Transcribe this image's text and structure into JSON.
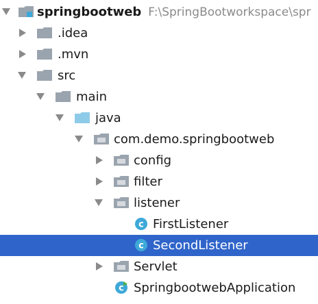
{
  "project": {
    "name": "springbootweb",
    "path": "F:\\SpringBootworkspace\\spr"
  },
  "tree": {
    "idea": ".idea",
    "mvn": ".mvn",
    "src": "src",
    "main": "main",
    "java": "java",
    "package": "com.demo.springbootweb",
    "config": "config",
    "filter": "filter",
    "listener": "listener",
    "first_listener": "FirstListener",
    "second_listener": "SecondListener",
    "servlet": "Servlet",
    "application": "SpringbootwebApplication"
  },
  "colors": {
    "selection": "#2f65ca",
    "folder_gray": "#9aa4ae",
    "folder_blue": "#8ecbe8",
    "class_icon": "#3ea9d8",
    "run_marker": "#4caf50"
  }
}
